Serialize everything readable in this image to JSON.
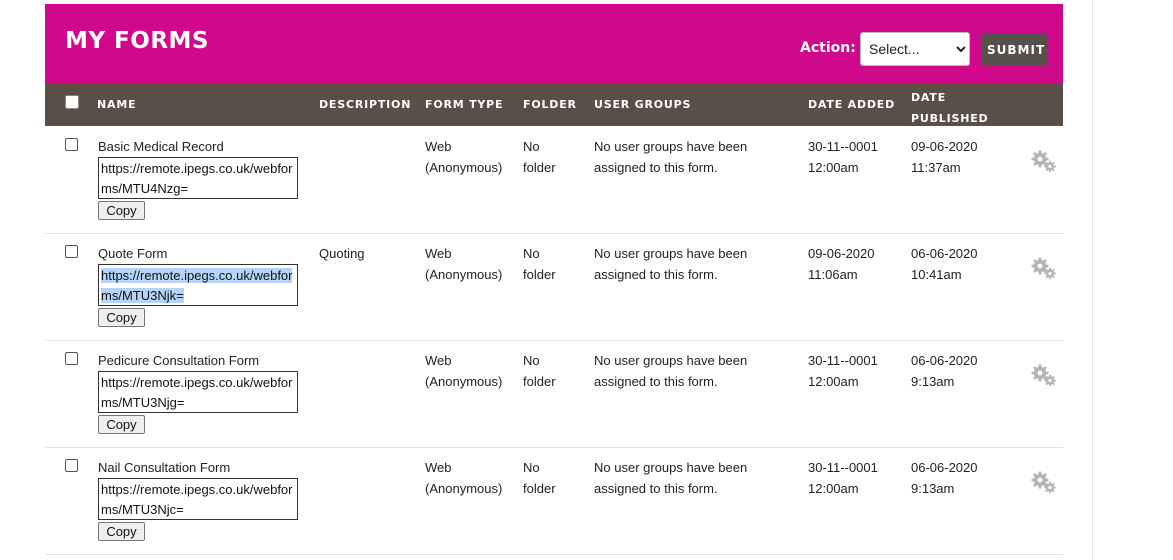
{
  "header": {
    "title": "MY FORMS",
    "action_label": "Action:",
    "action_select_value": "Select...",
    "submit_label": "SUBMIT"
  },
  "columns": {
    "name": "NAME",
    "description": "DESCRIPTION",
    "form_type": "FORM TYPE",
    "folder": "FOLDER",
    "user_groups": "USER GROUPS",
    "date_added": "DATE ADDED",
    "date_published_1": "DATE",
    "date_published_2": "PUBLISHED"
  },
  "copy_label": "Copy",
  "rows": [
    {
      "name": "Basic Medical Record",
      "url_1": "https://remote.ipegs.co.uk/webfor",
      "url_2": "ms/MTU4Nzg=",
      "description": "",
      "form_type_1": "Web",
      "form_type_2": "(Anonymous)",
      "folder_1": "No",
      "folder_2": "folder",
      "groups_1": "No user groups have been",
      "groups_2": "assigned to this form.",
      "added_1": "30-11--0001",
      "added_2": "12:00am",
      "published_1": "09-06-2020",
      "published_2": "11:37am"
    },
    {
      "name": "Quote Form",
      "url_1": "https://remote.ipegs.co.uk/webfor",
      "url_2": "ms/MTU3Njk=",
      "description": "Quoting",
      "form_type_1": "Web",
      "form_type_2": "(Anonymous)",
      "folder_1": "No",
      "folder_2": "folder",
      "groups_1": "No user groups have been",
      "groups_2": "assigned to this form.",
      "added_1": "09-06-2020",
      "added_2": "11:06am",
      "published_1": "06-06-2020",
      "published_2": "10:41am"
    },
    {
      "name": "Pedicure Consultation Form",
      "url_1": "https://remote.ipegs.co.uk/webfor",
      "url_2": "ms/MTU3Njg=",
      "description": "",
      "form_type_1": "Web",
      "form_type_2": "(Anonymous)",
      "folder_1": "No",
      "folder_2": "folder",
      "groups_1": "No user groups have been",
      "groups_2": "assigned to this form.",
      "added_1": "30-11--0001",
      "added_2": "12:00am",
      "published_1": "06-06-2020",
      "published_2": "9:13am"
    },
    {
      "name": "Nail Consultation Form",
      "url_1": "https://remote.ipegs.co.uk/webfor",
      "url_2": "ms/MTU3Njc=",
      "description": "",
      "form_type_1": "Web",
      "form_type_2": "(Anonymous)",
      "folder_1": "No",
      "folder_2": "folder",
      "groups_1": "No user groups have been",
      "groups_2": "assigned to this form.",
      "added_1": "30-11--0001",
      "added_2": "12:00am",
      "published_1": "06-06-2020",
      "published_2": "9:13am"
    }
  ],
  "colors": {
    "banner": "#d0088b",
    "table_header": "#5a4f48",
    "submit": "#555049",
    "selection_highlight": "#b3d4fc"
  },
  "icons": {
    "row_action": "gear-icon"
  }
}
